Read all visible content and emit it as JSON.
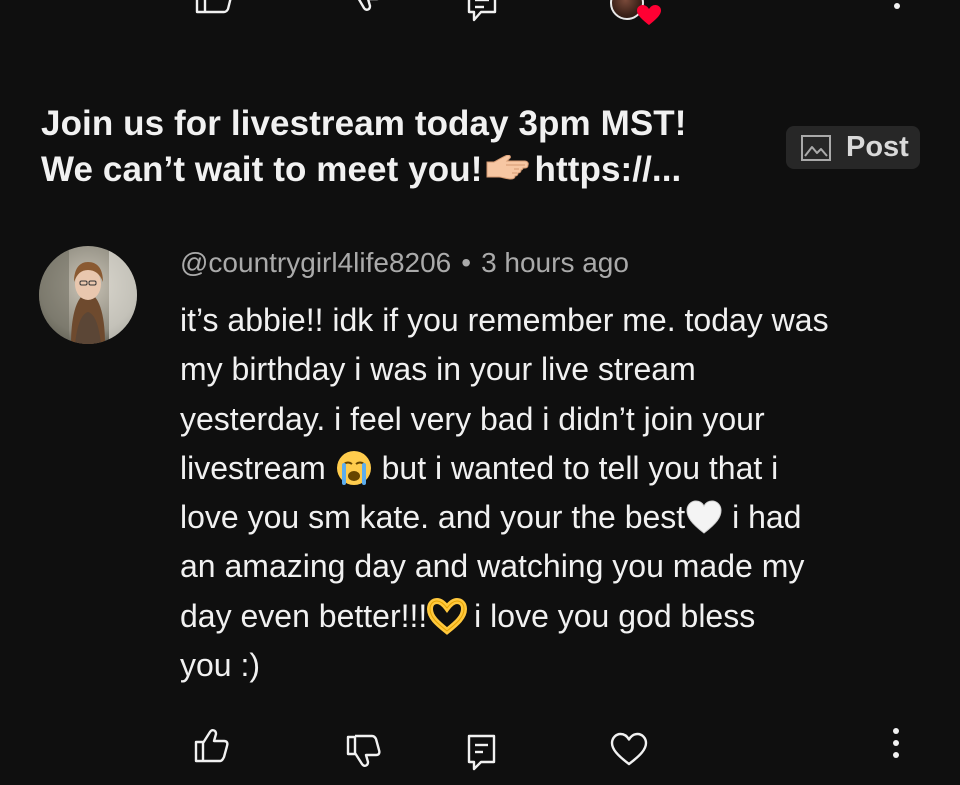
{
  "header": {
    "title_line1": "Join us for livestream today 3pm MST!",
    "title_line2_a": "We can’t wait to meet you!",
    "title_line2_b": "https://...",
    "post_chip_label": "Post"
  },
  "comment": {
    "author": "@countrygirl4life8206",
    "separator": "•",
    "time": "3 hours ago",
    "lines": [
      {
        "text": "it’s abbie!! idk if you remember me. today was"
      },
      {
        "text": "my birthday i was in your live stream"
      },
      {
        "text": "yesterday. i feel very bad i didn’t join your"
      },
      {
        "a": "livestream",
        "b": " but i wanted to tell you that i"
      },
      {
        "a": "love you sm kate. and your the best",
        "b": " i had"
      },
      {
        "text": "an amazing day and watching you made my"
      },
      {
        "a": "day even better!!!",
        "b": " i love you god bless"
      },
      {
        "text": "you :)"
      }
    ]
  },
  "icons": {
    "top_row": [
      "thumbs-up-icon",
      "thumbs-down-icon",
      "reply-icon",
      "creator-heart-icon",
      "more-icon"
    ],
    "bottom_row": [
      "thumbs-up-icon",
      "thumbs-down-icon",
      "reply-icon",
      "heart-icon",
      "more-icon"
    ],
    "inline_emoji": [
      "backhand-index-pointing-right-emoji",
      "loudly-crying-face-emoji",
      "white-heart-emoji",
      "heart-hands-emoji"
    ]
  },
  "colors": {
    "background": "#0f0f0f",
    "text_primary": "#f1f1f1",
    "text_secondary": "#aaaaaa",
    "chip_background": "#272727",
    "heart_badge": "#ff0033"
  }
}
